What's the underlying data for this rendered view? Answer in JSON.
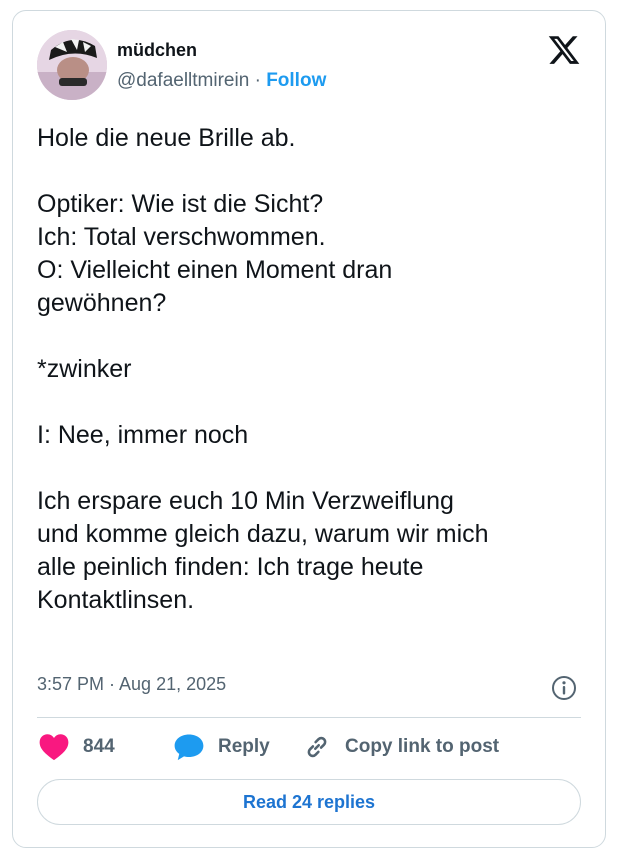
{
  "author": {
    "name": "müdchen",
    "handle": "@dafaelltmirein",
    "separator": "·",
    "follow_label": "Follow"
  },
  "tweet": {
    "text": "Hole die neue Brille ab.\n\nOptiker: Wie ist die Sicht?\nIch: Total verschwommen.\nO: Vielleicht einen Moment dran\ngewöhnen?\n\n*zwinker\n\nI: Nee, immer noch\n\nIch erspare euch 10 Min Verzweiflung\nund komme gleich dazu, warum wir mich\nalle peinlich finden: Ich trage heute\nKontaktlinsen.",
    "timestamp": "3:57 PM · Aug 21, 2025"
  },
  "actions": {
    "likes": "844",
    "reply_label": "Reply",
    "copy_link_label": "Copy link to post"
  },
  "read_replies_label": "Read 24 replies",
  "colors": {
    "accent": "#1d9bf0",
    "like": "#f91880",
    "text": "#0f1419",
    "muted": "#536471",
    "border": "#cfd9de"
  },
  "icons": [
    "avatar-image",
    "x-logo-icon",
    "info-icon",
    "heart-icon",
    "reply-bubble-icon",
    "link-icon"
  ]
}
